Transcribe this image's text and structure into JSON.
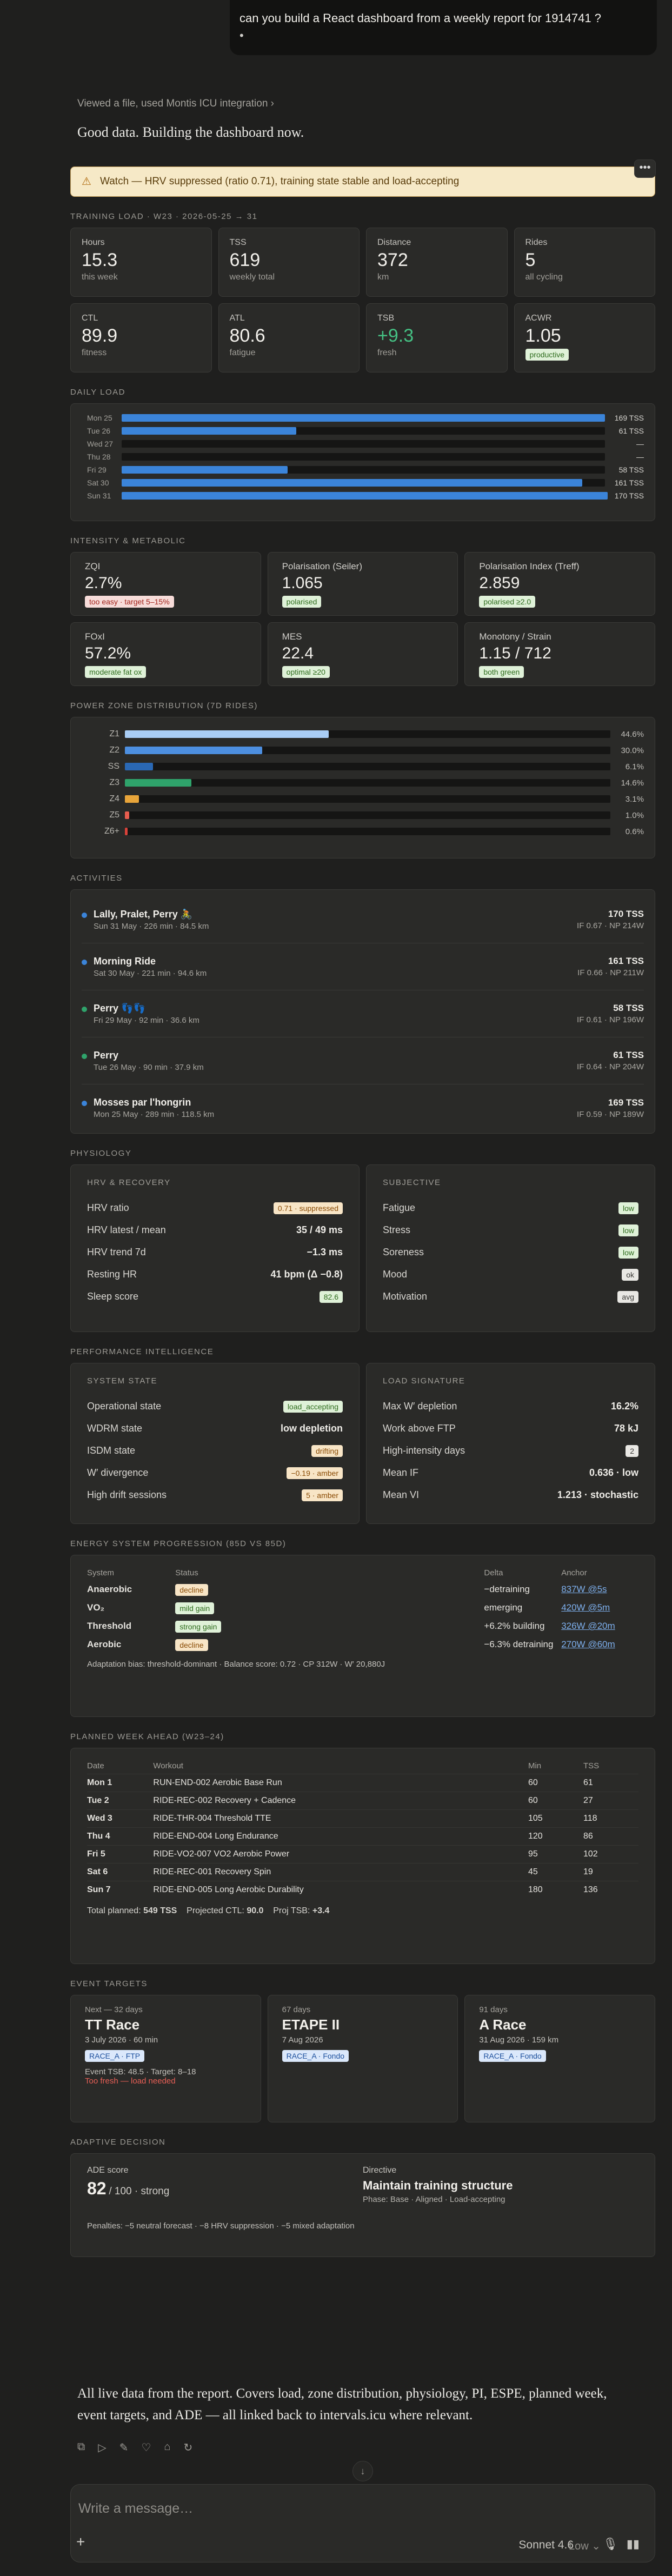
{
  "chat": {
    "user_message": "can you build a React dashboard from a weekly report for 1914741 ?",
    "user_message_tail": "•",
    "tool_line": "Viewed a file, used Montis ICU integration",
    "reply_intro": "Good data. Building the dashboard now.",
    "outro": "All live data from the report. Covers load, zone distribution, physiology, PI, ESPE, planned week, event targets, and ADE — all linked back to intervals.icu where relevant."
  },
  "dashboard": {
    "watch_banner": "Watch — HRV suppressed (ratio 0.71), training state stable and load-accepting",
    "training_load": {
      "section": "TRAINING LOAD · W23 · 2026-05-25 → 31",
      "stats": [
        {
          "label": "Hours",
          "value": "15.3",
          "sub": "this week"
        },
        {
          "label": "TSS",
          "value": "619",
          "sub": "weekly total"
        },
        {
          "label": "Distance",
          "value": "372",
          "sub": "km"
        },
        {
          "label": "Rides",
          "value": "5",
          "sub": "all cycling"
        },
        {
          "label": "CTL",
          "value": "89.9",
          "sub": "fitness"
        },
        {
          "label": "ATL",
          "value": "80.6",
          "sub": "fatigue"
        },
        {
          "label": "TSB",
          "value": "+9.3",
          "sub": "fresh"
        },
        {
          "label": "ACWR",
          "value": "1.05",
          "badge": "productive"
        }
      ]
    },
    "daily_load": {
      "section": "DAILY LOAD",
      "max": 169,
      "days": [
        {
          "day": "Mon 25",
          "tss": 169,
          "label": "169 TSS"
        },
        {
          "day": "Tue 26",
          "tss": 61,
          "label": "61 TSS"
        },
        {
          "day": "Wed 27",
          "tss": 0,
          "label": "—"
        },
        {
          "day": "Thu 28",
          "tss": 0,
          "label": "—"
        },
        {
          "day": "Fri 29",
          "tss": 58,
          "label": "58 TSS"
        },
        {
          "day": "Sat 30",
          "tss": 161,
          "label": "161 TSS"
        },
        {
          "day": "Sun 31",
          "tss": 170,
          "label": "170 TSS"
        }
      ]
    },
    "intensity": {
      "section": "INTENSITY & METABOLIC",
      "cards": [
        {
          "label": "ZQI",
          "value": "2.7%",
          "badge": "too easy · target 5–15%",
          "tone": "red"
        },
        {
          "label": "Polarisation (Seiler)",
          "value": "1.065",
          "badge": "polarised",
          "tone": "green"
        },
        {
          "label": "Polarisation Index (Treff)",
          "value": "2.859",
          "badge": "polarised ≥2.0",
          "tone": "green"
        },
        {
          "label": "FOxI",
          "value": "57.2%",
          "badge": "moderate fat ox",
          "tone": "green"
        },
        {
          "label": "MES",
          "value": "22.4",
          "badge": "optimal ≥20",
          "tone": "green"
        },
        {
          "label": "Monotony / Strain",
          "value": "1.15 / 712",
          "badge": "both green",
          "tone": "green"
        }
      ]
    },
    "power_zones": {
      "section": "POWER ZONE DISTRIBUTION (7D RIDES)",
      "zones": [
        {
          "zone": "Z1",
          "pct": 44.6,
          "label": "44.6%",
          "color": "#a9cdf5"
        },
        {
          "zone": "Z2",
          "pct": 30.0,
          "label": "30.0%",
          "color": "#4d8fe0"
        },
        {
          "zone": "SS",
          "pct": 6.1,
          "label": "6.1%",
          "color": "#2a68b4"
        },
        {
          "zone": "Z3",
          "pct": 14.6,
          "label": "14.6%",
          "color": "#2fa36b"
        },
        {
          "zone": "Z4",
          "pct": 3.1,
          "label": "3.1%",
          "color": "#e8a53a"
        },
        {
          "zone": "Z5",
          "pct": 1.0,
          "label": "1.0%",
          "color": "#e85d4e"
        },
        {
          "zone": "Z6+",
          "pct": 0.6,
          "label": "0.6%",
          "color": "#d8423a"
        }
      ]
    },
    "activities": {
      "section": "ACTIVITIES",
      "items": [
        {
          "name": "Lally, Pralet, Perry 🚴",
          "meta": "Sun 31 May · 226 min · 84.5 km",
          "tss": "170 TSS",
          "ifnp": "IF 0.67 · NP 214W",
          "dot": "#3b84d9"
        },
        {
          "name": "Morning Ride",
          "meta": "Sat 30 May · 221 min · 94.6 km",
          "tss": "161 TSS",
          "ifnp": "IF 0.66 · NP 211W",
          "dot": "#3b84d9"
        },
        {
          "name": "Perry 👣👣",
          "meta": "Fri 29 May · 92 min · 36.6 km",
          "tss": "58 TSS",
          "ifnp": "IF 0.61 · NP 196W",
          "dot": "#2fa36b"
        },
        {
          "name": "Perry",
          "meta": "Tue 26 May · 90 min · 37.9 km",
          "tss": "61 TSS",
          "ifnp": "IF 0.64 · NP 204W",
          "dot": "#2fa36b"
        },
        {
          "name": "Mosses par l'hongrin",
          "meta": "Mon 25 May · 289 min · 118.5 km",
          "tss": "169 TSS",
          "ifnp": "IF 0.59 · NP 189W",
          "dot": "#3b84d9"
        }
      ]
    },
    "physiology": {
      "section": "PHYSIOLOGY",
      "hrv_head": "HRV & RECOVERY",
      "hrv": [
        {
          "k": "HRV ratio",
          "v": "0.71 · suppressed",
          "badge": "amber"
        },
        {
          "k": "HRV latest / mean",
          "v": "35 / 49 ms"
        },
        {
          "k": "HRV trend 7d",
          "v": "−1.3 ms"
        },
        {
          "k": "Resting HR",
          "v": "41 bpm (Δ −0.8)"
        },
        {
          "k": "Sleep score",
          "v": "82.6",
          "badge": "green"
        }
      ],
      "subj_head": "SUBJECTIVE",
      "subjective": [
        {
          "k": "Fatigue",
          "v": "low",
          "badge": "green"
        },
        {
          "k": "Stress",
          "v": "low",
          "badge": "green"
        },
        {
          "k": "Soreness",
          "v": "low",
          "badge": "green"
        },
        {
          "k": "Mood",
          "v": "ok",
          "badge": "gray"
        },
        {
          "k": "Motivation",
          "v": "avg",
          "badge": "gray"
        }
      ]
    },
    "performance": {
      "section": "PERFORMANCE INTELLIGENCE",
      "state_head": "SYSTEM STATE",
      "state": [
        {
          "k": "Operational state",
          "v": "load_accepting",
          "badge": "green"
        },
        {
          "k": "WDRM state",
          "v": "low depletion"
        },
        {
          "k": "ISDM state",
          "v": "drifting",
          "badge": "amber"
        },
        {
          "k": "W′ divergence",
          "v": "−0.19 · amber",
          "badge": "amber"
        },
        {
          "k": "High drift sessions",
          "v": "5 · amber",
          "badge": "amber"
        }
      ],
      "load_head": "LOAD SIGNATURE",
      "load": [
        {
          "k": "Max W′ depletion",
          "v": "16.2%"
        },
        {
          "k": "Work above FTP",
          "v": "78 kJ"
        },
        {
          "k": "High-intensity days",
          "v": "2",
          "badge": "gray"
        },
        {
          "k": "Mean IF",
          "v": "0.636 · low"
        },
        {
          "k": "Mean VI",
          "v": "1.213 · stochastic"
        }
      ]
    },
    "espe": {
      "section": "ENERGY SYSTEM PROGRESSION (85D VS 85D)",
      "headers": [
        "System",
        "Status",
        "Delta",
        "Anchor"
      ],
      "rows": [
        {
          "system": "Anaerobic",
          "status": "decline",
          "tone": "amber",
          "delta": "−detraining",
          "delta_tone": "neg",
          "anchor": "837W @5s"
        },
        {
          "system": "VO₂",
          "status": "mild gain",
          "tone": "green",
          "delta": "emerging",
          "delta_tone": "pos",
          "anchor": "420W @5m"
        },
        {
          "system": "Threshold",
          "status": "strong gain",
          "tone": "green",
          "delta": "+6.2% building",
          "delta_tone": "pos",
          "anchor": "326W @20m"
        },
        {
          "system": "Aerobic",
          "status": "decline",
          "tone": "amber",
          "delta": "−6.3% detraining",
          "delta_tone": "neg",
          "anchor": "270W @60m"
        }
      ],
      "footer": "Adaptation bias: threshold-dominant · Balance score: 0.72 · CP 312W · W′ 20,880J"
    },
    "plan": {
      "section": "PLANNED WEEK AHEAD (W23–24)",
      "headers": [
        "Date",
        "Workout",
        "Min",
        "TSS"
      ],
      "rows": [
        {
          "date": "Mon 1",
          "workout": "RUN-END-002 Aerobic Base Run",
          "min": "60",
          "tss": "61"
        },
        {
          "date": "Tue 2",
          "workout": "RIDE-REC-002 Recovery + Cadence",
          "min": "60",
          "tss": "27"
        },
        {
          "date": "Wed 3",
          "workout": "RIDE-THR-004 Threshold TTE",
          "min": "105",
          "tss": "118"
        },
        {
          "date": "Thu 4",
          "workout": "RIDE-END-004 Long Endurance",
          "min": "120",
          "tss": "86"
        },
        {
          "date": "Fri 5",
          "workout": "RIDE-VO2-007 VO2 Aerobic Power",
          "min": "95",
          "tss": "102"
        },
        {
          "date": "Sat 6",
          "workout": "RIDE-REC-001 Recovery Spin",
          "min": "45",
          "tss": "19"
        },
        {
          "date": "Sun 7",
          "workout": "RIDE-END-005 Long Aerobic Durability",
          "min": "180",
          "tss": "136"
        }
      ],
      "total_label": "Total planned:",
      "total": "549 TSS",
      "ctl_label": "Projected CTL:",
      "ctl": "90.0",
      "tsb_label": "Proj TSB:",
      "tsb": "+3.4"
    },
    "events": {
      "section": "EVENT TARGETS",
      "items": [
        {
          "small": "Next — 32 days",
          "name": "TT Race",
          "date": "3 July 2026 · 60 min",
          "badge": "RACE_A · FTP",
          "extra": "Event TSB: 48.5 · Target: 8–18",
          "warn": "Too fresh — load needed"
        },
        {
          "small": "67 days",
          "name": "ETAPE II",
          "date": "7 Aug 2026",
          "badge": "RACE_A · Fondo"
        },
        {
          "small": "91 days",
          "name": "A Race",
          "date": "31 Aug 2026 · 159 km",
          "badge": "RACE_A · Fondo"
        }
      ]
    },
    "ade": {
      "section": "ADAPTIVE DECISION",
      "score_label": "ADE score",
      "score": "82",
      "score_suffix": "/ 100 · strong",
      "dir_label": "Directive",
      "directive": "Maintain training structure",
      "phase": "Phase: Base · Aligned · Load-accepting",
      "penalties": "Penalties: −5 neutral forecast · −8 HRV suppression · −5 mixed adaptation"
    }
  },
  "composer": {
    "placeholder": "Write a message…",
    "model": "Sonnet 4.6",
    "effort": "Low"
  }
}
